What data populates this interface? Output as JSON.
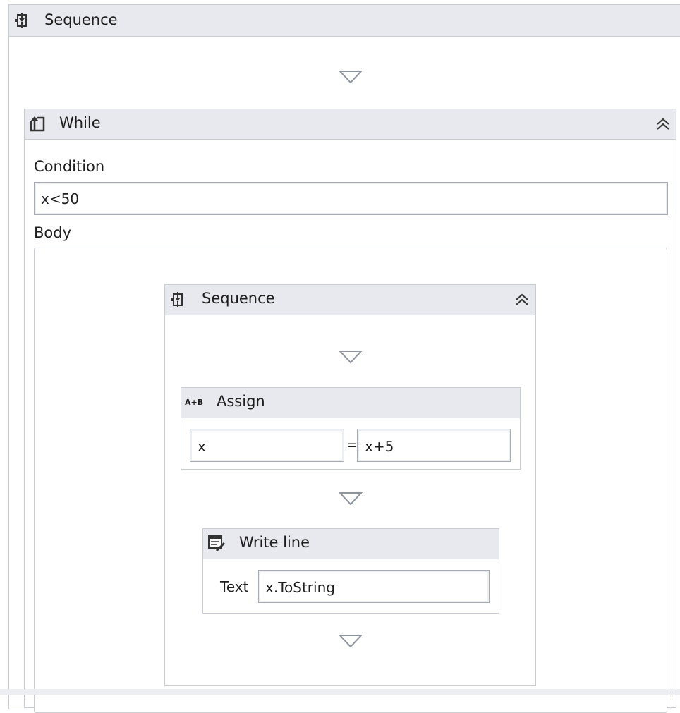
{
  "outer_sequence": {
    "title": "Sequence",
    "icon": "sequence-icon"
  },
  "while": {
    "title": "While",
    "icon": "while-loop-icon",
    "condition_label": "Condition",
    "condition_value": "x<50",
    "body_label": "Body",
    "collapse_icon": "collapse-chevron-icon"
  },
  "inner_sequence": {
    "title": "Sequence",
    "icon": "sequence-icon",
    "collapse_icon": "collapse-chevron-icon"
  },
  "assign": {
    "title": "Assign",
    "icon_text": "A+B",
    "to_value": "x",
    "equals": "=",
    "value": "x+5"
  },
  "writeline": {
    "title": "Write line",
    "icon": "write-line-icon",
    "text_label": "Text",
    "text_value": "x.ToString"
  },
  "colors": {
    "header_bg": "#e7e9ee",
    "border": "#c9ccd3",
    "drop_arrow": "#8f949e"
  }
}
